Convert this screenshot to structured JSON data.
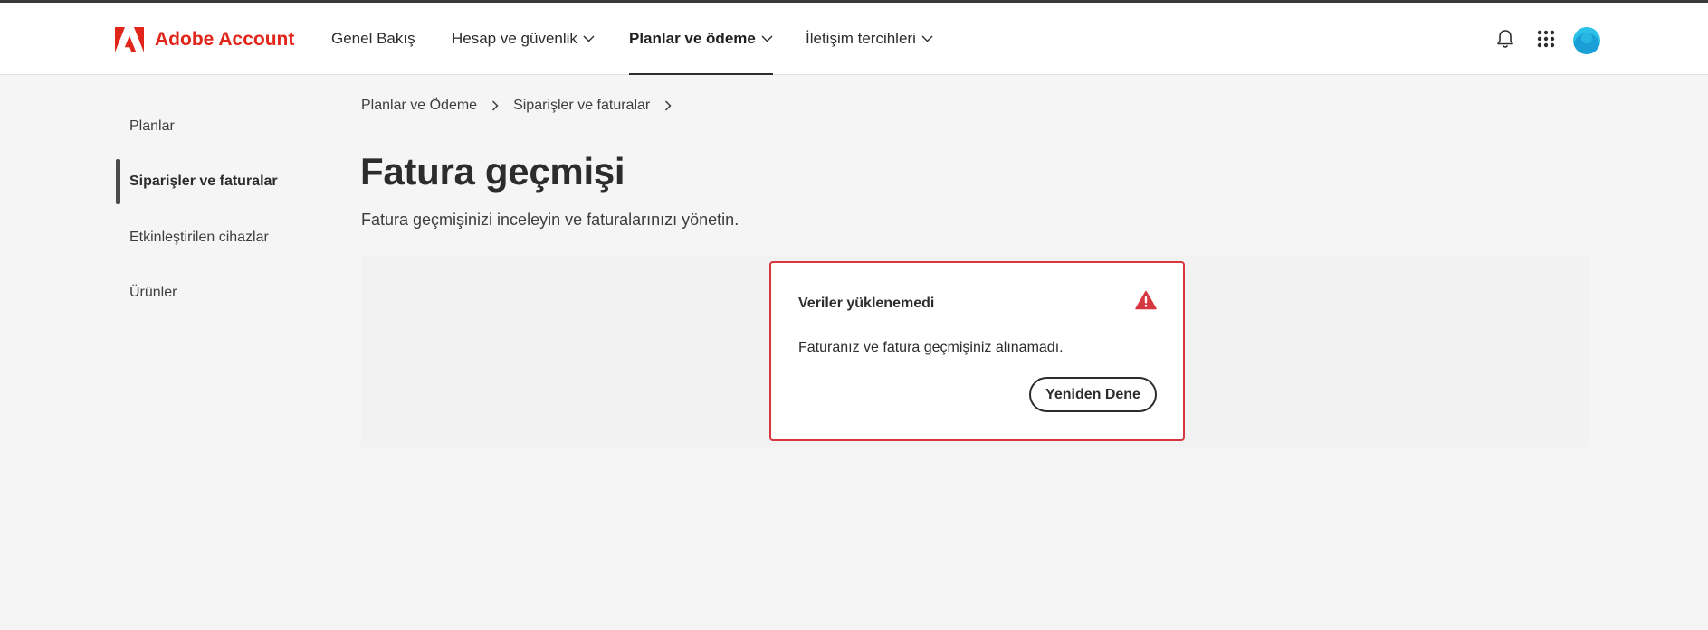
{
  "header": {
    "brand": "Adobe Account",
    "brand_color": "#e1251b",
    "nav": [
      {
        "label": "Genel Bakış",
        "has_dropdown": false,
        "active": false
      },
      {
        "label": "Hesap ve güvenlik",
        "has_dropdown": true,
        "active": false
      },
      {
        "label": "Planlar ve ödeme",
        "has_dropdown": true,
        "active": true
      },
      {
        "label": "İletişim tercihleri",
        "has_dropdown": true,
        "active": false
      }
    ],
    "icons": [
      "bell-icon",
      "apps-grid-icon",
      "avatar"
    ]
  },
  "sidebar": {
    "items": [
      {
        "label": "Planlar",
        "active": false
      },
      {
        "label": "Siparişler ve faturalar",
        "active": true
      },
      {
        "label": "Etkinleştirilen cihazlar",
        "active": false
      },
      {
        "label": "Ürünler",
        "active": false
      }
    ]
  },
  "breadcrumb": [
    "Planlar ve Ödeme",
    "Siparişler ve faturalar"
  ],
  "main": {
    "title": "Fatura geçmişi",
    "subtitle": "Fatura geçmişinizi inceleyin ve faturalarınızı yönetin."
  },
  "alert": {
    "title": "Veriler yüklenemedi",
    "message": "Faturanız ve fatura geçmişiniz alınamadı.",
    "button_label": "Yeniden Dene",
    "icon": "warning-icon",
    "color": "#d7373f"
  }
}
